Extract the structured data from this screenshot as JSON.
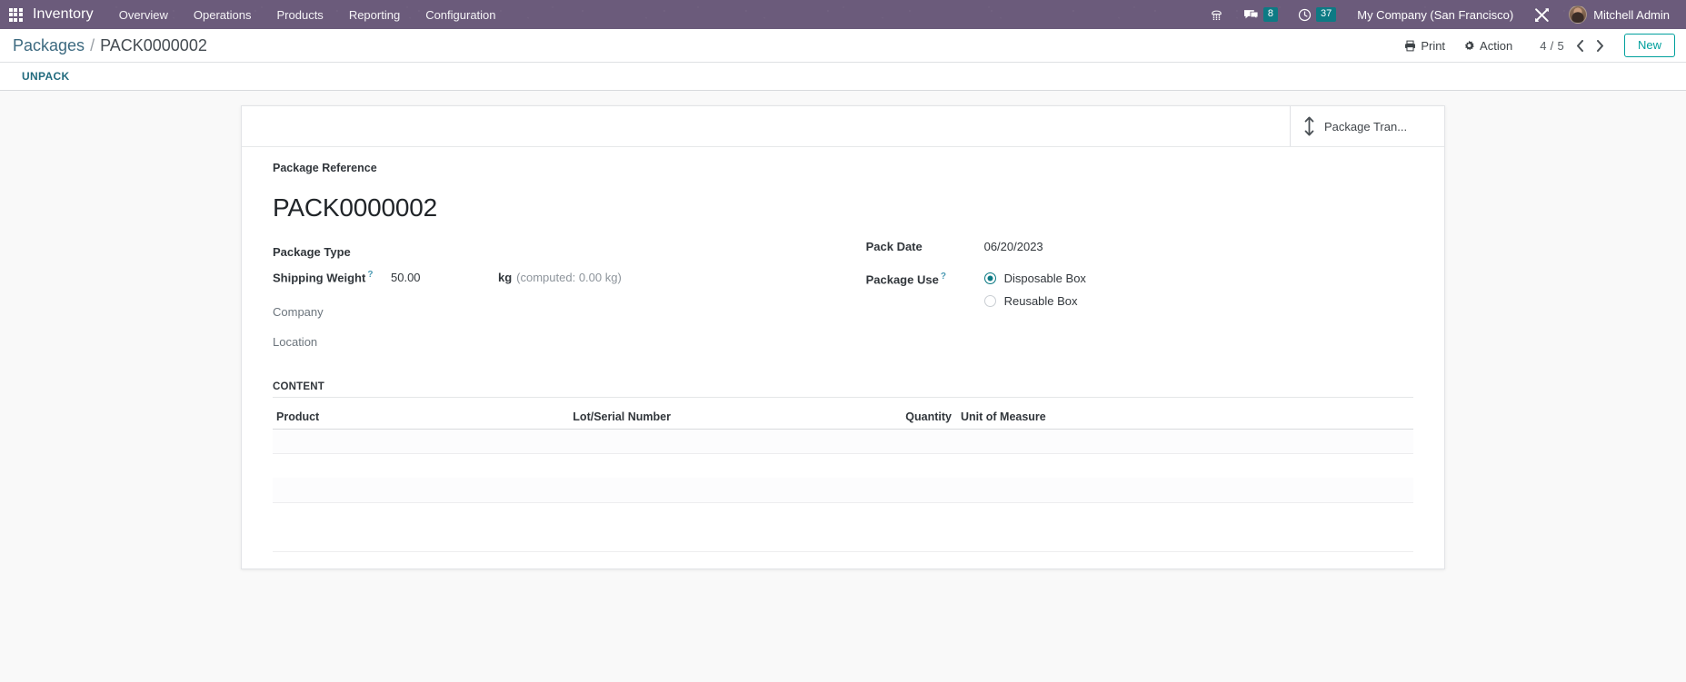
{
  "navbar": {
    "apps_icon": "grid-apps-icon",
    "brand": "Inventory",
    "menus": [
      {
        "label": "Overview"
      },
      {
        "label": "Operations"
      },
      {
        "label": "Products"
      },
      {
        "label": "Reporting"
      },
      {
        "label": "Configuration"
      }
    ],
    "sys": {
      "activities_icon": "activities-clock-icon",
      "messages_icon": "messages-chat-icon",
      "messages_count": "8",
      "activities_count": "37"
    },
    "company": "My Company (San Francisco)",
    "debug_icon": "developer-tools-icon",
    "user_name": "Mitchell Admin",
    "avatar_icon": "user-avatar"
  },
  "control_panel": {
    "breadcrumb_root": "Packages",
    "breadcrumb_separator": "/",
    "breadcrumb_current": "PACK0000002",
    "print_label": "Print",
    "print_icon": "printer-icon",
    "action_label": "Action",
    "action_icon": "gear-icon",
    "pager_value": "4 / 5",
    "pager_prev_icon": "chevron-left-icon",
    "pager_next_icon": "chevron-right-icon",
    "new_label": "New",
    "status_button": "UNPACK"
  },
  "smart_buttons": [
    {
      "label": "Package Tran...",
      "icon": "arrows-up-down-icon"
    }
  ],
  "form": {
    "title_label": "Package Reference",
    "title_value": "PACK0000002",
    "left_fields": [
      {
        "name": "package-type",
        "label": "Package Type",
        "value": "",
        "muted": false,
        "tip": false
      },
      {
        "name": "shipping-weight",
        "label": "Shipping Weight",
        "value": "50.00",
        "muted": false,
        "tip": true,
        "unit": "kg",
        "computed": "(computed: 0.00  kg)"
      },
      {
        "name": "company",
        "label": "Company",
        "value": "",
        "muted": true,
        "tip": false
      },
      {
        "name": "location",
        "label": "Location",
        "value": "",
        "muted": true,
        "tip": false
      }
    ],
    "pack_date": {
      "label": "Pack Date",
      "value": "06/20/2023"
    },
    "package_use": {
      "label": "Package Use",
      "tip": true,
      "options": [
        {
          "label": "Disposable Box",
          "checked": true
        },
        {
          "label": "Reusable Box",
          "checked": false
        }
      ]
    }
  },
  "content": {
    "section_title": "CONTENT",
    "columns": [
      "Product",
      "Lot/Serial Number",
      "Quantity",
      "Unit of Measure"
    ],
    "rows": []
  },
  "colors": {
    "navbar_bg": "#6b5b7b",
    "accent_teal": "#00a09d",
    "badge_bg": "#0d7a84",
    "link_blue": "#3d6a80",
    "sheet_bg": "#ffffff",
    "page_bg": "#f9f9f9"
  }
}
